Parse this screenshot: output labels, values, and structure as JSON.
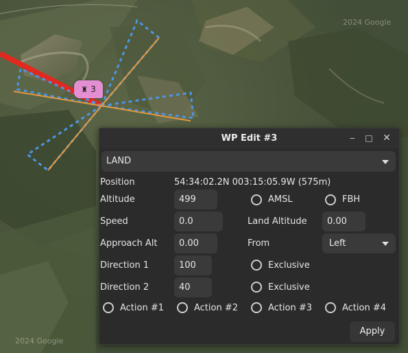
{
  "map": {
    "watermark_top": "2024 Google",
    "watermark_bottom": "2024 Google",
    "colors": {
      "path": "#e0291f",
      "fence": "#4c96e6",
      "approach": "#e3993e"
    }
  },
  "marker": {
    "icon": "rook-icon",
    "label": "3"
  },
  "dialog": {
    "title": "WP Edit #3",
    "window_buttons": {
      "minimize": "‒",
      "maximize": "□",
      "close": "✕"
    },
    "command": "LAND",
    "position_label": "Position",
    "position_value": "54:34:02.2N 003:15:05.9W (575m)",
    "altitude_label": "Altitude",
    "altitude_value": "499",
    "amsl_label": "AMSL",
    "fbh_label": "FBH",
    "speed_label": "Speed",
    "speed_value": "0.0",
    "land_altitude_label": "Land Altitude",
    "land_altitude_value": "0.00",
    "approach_alt_label": "Approach Alt",
    "approach_alt_value": "0.00",
    "from_label": "From",
    "from_value": "Left",
    "direction1_label": "Direction 1",
    "direction1_value": "100",
    "exclusive1_label": "Exclusive",
    "direction2_label": "Direction 2",
    "direction2_value": "40",
    "exclusive2_label": "Exclusive",
    "actions": [
      "Action #1",
      "Action #2",
      "Action #3",
      "Action #4"
    ],
    "apply_label": "Apply"
  }
}
